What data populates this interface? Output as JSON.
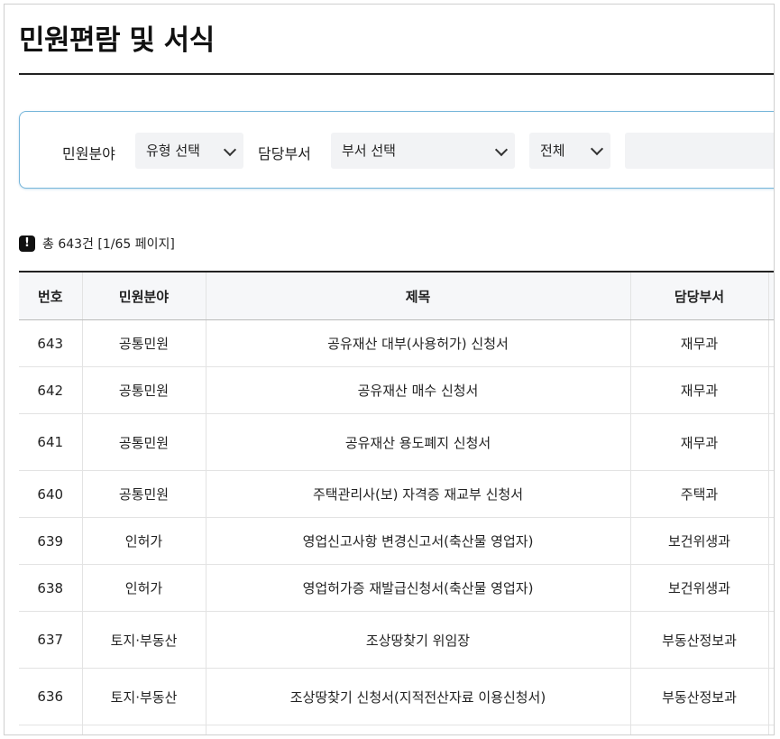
{
  "page": {
    "title": "민원편람 및 서식"
  },
  "search": {
    "category_label": "민원분야",
    "category_selected": "유형 선택",
    "dept_label": "담당부서",
    "dept_selected": "부서 선택",
    "scope_selected": "전체",
    "keyword_value": ""
  },
  "summary": {
    "icon": "exclamation-icon",
    "text": "총 643건 [1/65 페이지]"
  },
  "table": {
    "headers": [
      "번호",
      "민원분야",
      "제목",
      "담당부서"
    ],
    "rows": [
      {
        "no": "643",
        "category": "공통민원",
        "title": "공유재산 대부(사용허가) 신청서",
        "dept": "재무과"
      },
      {
        "no": "642",
        "category": "공통민원",
        "title": "공유재산 매수 신청서",
        "dept": "재무과"
      },
      {
        "no": "641",
        "category": "공통민원",
        "title": "공유재산 용도폐지 신청서",
        "dept": "재무과"
      },
      {
        "no": "640",
        "category": "공통민원",
        "title": "주택관리사(보) 자격증 재교부 신청서",
        "dept": "주택과"
      },
      {
        "no": "639",
        "category": "인허가",
        "title": "영업신고사항 변경신고서(축산물 영업자)",
        "dept": "보건위생과"
      },
      {
        "no": "638",
        "category": "인허가",
        "title": "영업허가증 재발급신청서(축산물 영업자)",
        "dept": "보건위생과"
      },
      {
        "no": "637",
        "category": "토지·부동산",
        "title": "조상땅찾기 위임장",
        "dept": "부동산정보과"
      },
      {
        "no": "636",
        "category": "토지·부동산",
        "title": "조상땅찾기 신청서(지적전산자료 이용신청서)",
        "dept": "부동산정보과"
      },
      {
        "no": "",
        "category": "",
        "title": "",
        "dept": ""
      }
    ]
  }
}
